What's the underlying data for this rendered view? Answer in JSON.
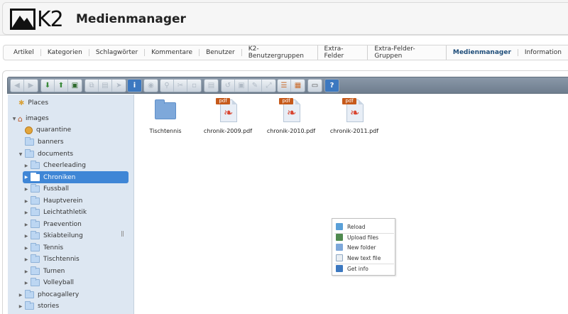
{
  "header": {
    "logo_text": "K2",
    "title": "Medienmanager"
  },
  "tabs": [
    {
      "label": "Artikel",
      "active": false
    },
    {
      "label": "Kategorien",
      "active": false
    },
    {
      "label": "Schlagwörter",
      "active": false
    },
    {
      "label": "Kommentare",
      "active": false
    },
    {
      "label": "Benutzer",
      "active": false
    },
    {
      "label": "K2-Benutzergruppen",
      "active": false
    },
    {
      "label": "Extra-Felder",
      "active": false
    },
    {
      "label": "Extra-Felder-Gruppen",
      "active": false
    },
    {
      "label": "Medienmanager",
      "active": true
    },
    {
      "label": "Information",
      "active": false
    }
  ],
  "toolbar": {
    "groups": [
      [
        "back-icon",
        "forward-icon"
      ],
      [
        "download-icon",
        "upload-icon",
        "save-icon"
      ],
      [
        "copy-icon",
        "floppy-icon",
        "select-icon"
      ],
      [
        "info-icon"
      ],
      [
        "view-icon"
      ],
      [
        "search-icon",
        "cut-icon",
        "paste-icon"
      ],
      [
        "delete-icon"
      ],
      [
        "extract-icon",
        "archive-icon",
        "edit-icon",
        "resize-icon"
      ],
      [
        "list-view-icon",
        "grid-view-icon"
      ],
      [
        "window-icon"
      ],
      [
        "help-icon"
      ]
    ]
  },
  "sidebar": {
    "places_label": "Places",
    "tree": [
      {
        "label": "images",
        "level": 0,
        "expanded": true,
        "icon": "home-icon"
      },
      {
        "label": "quarantine",
        "level": 1,
        "icon": "quarantine-icon"
      },
      {
        "label": "banners",
        "level": 1,
        "icon": "folder-icon"
      },
      {
        "label": "documents",
        "level": 1,
        "expanded": true,
        "icon": "folder-icon"
      },
      {
        "label": "Cheerleading",
        "level": 2,
        "icon": "folder-icon"
      },
      {
        "label": "Chroniken",
        "level": 2,
        "selected": true,
        "icon": "folder-icon"
      },
      {
        "label": "Fussball",
        "level": 2,
        "icon": "folder-icon"
      },
      {
        "label": "Hauptverein",
        "level": 2,
        "icon": "folder-icon"
      },
      {
        "label": "Leichtathletik",
        "level": 2,
        "icon": "folder-icon"
      },
      {
        "label": "Praevention",
        "level": 2,
        "icon": "folder-icon"
      },
      {
        "label": "Skiabteilung",
        "level": 2,
        "icon": "folder-icon"
      },
      {
        "label": "Tennis",
        "level": 2,
        "icon": "folder-icon"
      },
      {
        "label": "Tischtennis",
        "level": 2,
        "icon": "folder-icon"
      },
      {
        "label": "Turnen",
        "level": 2,
        "icon": "folder-icon"
      },
      {
        "label": "Volleyball",
        "level": 2,
        "icon": "folder-icon"
      },
      {
        "label": "phocagallery",
        "level": 1,
        "icon": "folder-icon"
      },
      {
        "label": "stories",
        "level": 1,
        "icon": "folder-icon"
      }
    ]
  },
  "files": [
    {
      "name": "Tischtennis",
      "type": "folder"
    },
    {
      "name": "chronik-2009.pdf",
      "type": "pdf"
    },
    {
      "name": "chronik-2010.pdf",
      "type": "pdf"
    },
    {
      "name": "chronik-2011.pdf",
      "type": "pdf"
    }
  ],
  "pdf_badge": "pdf",
  "context_menu": {
    "items": [
      {
        "label": "Reload",
        "icon": "reload-icon"
      },
      {
        "label": "Upload files",
        "icon": "upload-files-icon"
      },
      {
        "label": "New folder",
        "icon": "new-folder-icon"
      },
      {
        "label": "New text file",
        "icon": "new-text-file-icon"
      },
      {
        "label": "Get info",
        "icon": "get-info-icon"
      }
    ]
  },
  "colors": {
    "selected": "#3f86d6",
    "active_tab": "#1f4e7a",
    "sidebar_bg": "#dde7f2",
    "pdf_tag": "#c65a1b"
  }
}
